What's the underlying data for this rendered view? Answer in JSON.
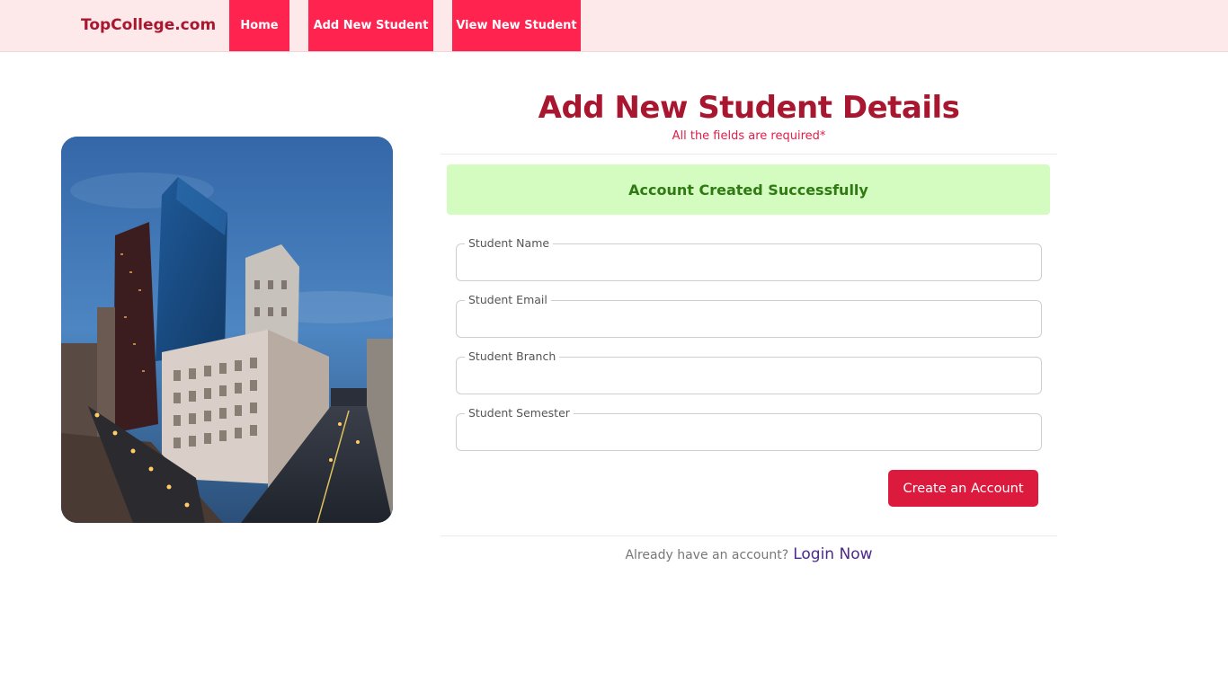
{
  "navbar": {
    "brand": "TopCollege.com",
    "links": [
      "Home",
      "Add New Student",
      "View New Student"
    ]
  },
  "form": {
    "title": "Add New Student Details",
    "subtitle": "All the fields are required*",
    "alert": "Account Created Successfully",
    "fields": [
      {
        "label": "Student Name",
        "value": ""
      },
      {
        "label": "Student Email",
        "value": ""
      },
      {
        "label": "Student Branch",
        "value": ""
      },
      {
        "label": "Student Semester",
        "value": ""
      }
    ],
    "submit_label": "Create an Account",
    "footer_text": "Already have an account?",
    "footer_link": "Login Now"
  },
  "colors": {
    "brand": "#a8172f",
    "nav_button": "#ff2450",
    "alert_bg": "#d4fcc0",
    "alert_text": "#2f7a12",
    "submit": "#dc1a3e"
  },
  "image": {
    "subject": "city-buildings-photo"
  }
}
